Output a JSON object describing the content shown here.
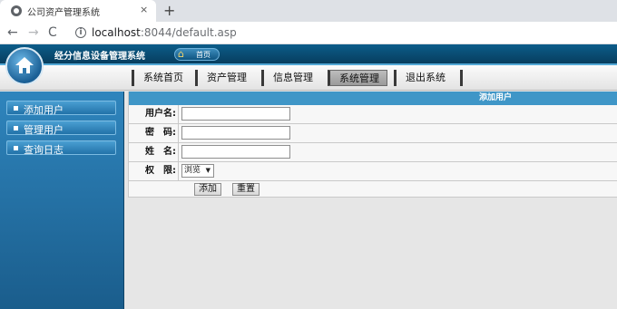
{
  "browser": {
    "tab_title": "公司资产管理系统",
    "tab_close": "×",
    "new_tab": "+",
    "nav_back": "←",
    "nav_forward": "→",
    "nav_reload": "C",
    "url_host": "localhost",
    "url_rest": ":8044/default.asp",
    "info_glyph": "i"
  },
  "header": {
    "system_title": "经分信息设备管理系统",
    "home_label": "首页",
    "home_icon": "house-icon"
  },
  "menu": {
    "items": [
      {
        "label": "系统首页"
      },
      {
        "label": "资产管理"
      },
      {
        "label": "信息管理"
      },
      {
        "label": "系统管理",
        "active": true
      },
      {
        "label": "退出系统"
      }
    ]
  },
  "sidebar": {
    "items": [
      {
        "label": "添加用户"
      },
      {
        "label": "管理用户"
      },
      {
        "label": "查询日志"
      }
    ]
  },
  "form": {
    "title": "添加用户",
    "username_label": "用户名:",
    "username_value": "",
    "password_label": "密　码:",
    "password_value": "",
    "name_label": "姓　名:",
    "name_value": "",
    "permission_label": "权　限:",
    "permission_value": "浏览",
    "submit_label": "添加",
    "reset_label": "重置"
  },
  "colors": {
    "banner": "#0c5d8a",
    "sidebar": "#2f85bd",
    "form_header": "#3f96c7"
  }
}
